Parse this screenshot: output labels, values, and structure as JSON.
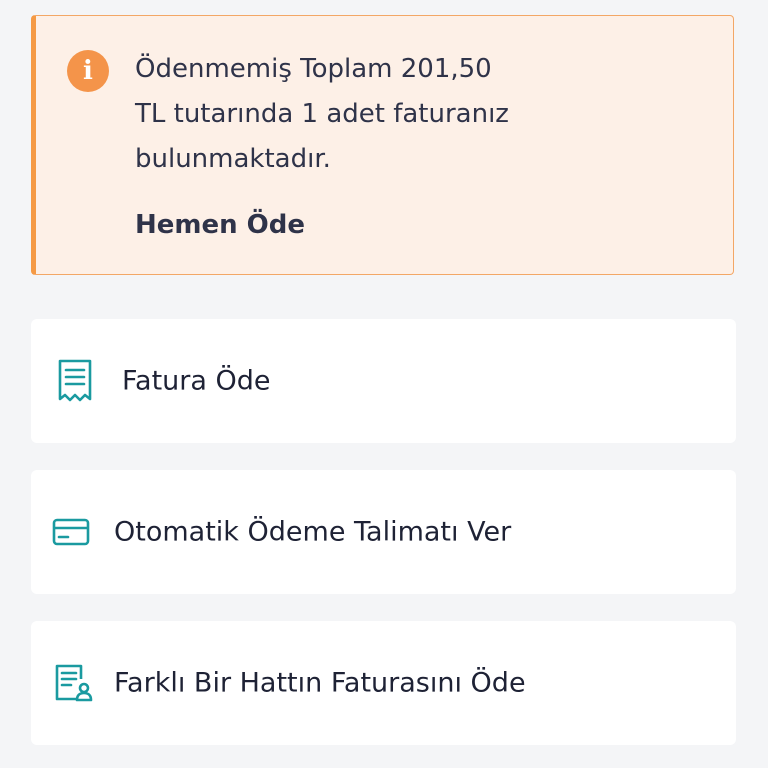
{
  "notice": {
    "icon": "info-icon",
    "message_line1": "Ödenmemiş Toplam 201,50",
    "message_line2": "TL tutarında 1 adet faturanız",
    "message_line3": "bulunmaktadır.",
    "action_label": "Hemen Öde",
    "accent_color": "#f59a45",
    "background_color": "#fdf0e7"
  },
  "menu": {
    "items": [
      {
        "label": "Fatura Öde",
        "icon": "receipt-icon"
      },
      {
        "label": "Otomatik Ödeme Talimatı Ver",
        "icon": "credit-card-icon"
      },
      {
        "label": "Farklı Bir Hattın Faturasını Öde",
        "icon": "user-invoice-icon"
      }
    ],
    "icon_color": "#1a9aa0"
  }
}
